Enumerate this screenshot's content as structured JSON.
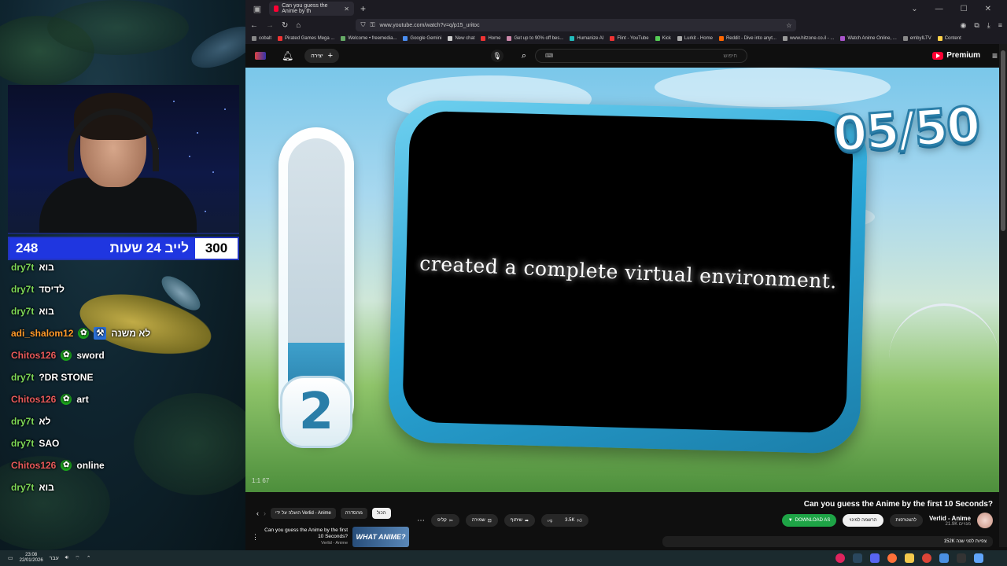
{
  "stream": {
    "counter": {
      "left_value": "248",
      "label": "לייב 24 שעות",
      "right_value": "300"
    },
    "chat": [
      {
        "user": "dry7t",
        "msg": "בוא",
        "color": "green",
        "badge": ""
      },
      {
        "user": "dry7t",
        "msg": "לדיסד",
        "color": "green",
        "badge": ""
      },
      {
        "user": "dry7t",
        "msg": "בוא",
        "color": "green",
        "badge": ""
      },
      {
        "user": "adi_shalom12",
        "msg": "לא משנה",
        "color": "orange",
        "badge": "both"
      },
      {
        "user": "Chitos126",
        "msg": "sword",
        "color": "red",
        "badge": "green"
      },
      {
        "user": "dry7t",
        "msg": "?DR STONE",
        "color": "green",
        "badge": ""
      },
      {
        "user": "Chitos126",
        "msg": "art",
        "color": "red",
        "badge": "green"
      },
      {
        "user": "dry7t",
        "msg": "לא",
        "color": "green",
        "badge": ""
      },
      {
        "user": "dry7t",
        "msg": "SAO",
        "color": "green",
        "badge": ""
      },
      {
        "user": "Chitos126",
        "msg": "online",
        "color": "red",
        "badge": "green"
      },
      {
        "user": "dry7t",
        "msg": "בוא",
        "color": "green",
        "badge": ""
      }
    ]
  },
  "browser": {
    "tab_title": "Can you guess the Anime by th",
    "url": "www.youtube.com/watch?v=q/p15_uritoc",
    "bookmarks": [
      "cobalt",
      "Pirated Games Mega ...",
      "Welcome • freemedia...",
      "Google Gemini",
      "New chat",
      "Home",
      "Get up to 90% off bes...",
      "Humanize AI",
      "Flint - YouTube",
      "Kick",
      "Lurkit - Home",
      "Reddit - Dive into anyt...",
      "www.hitzone.co.il - ...",
      "Watch Anime Online, ...",
      "embyILTV",
      "Content"
    ]
  },
  "youtube": {
    "create_label": "יצירה",
    "search_placeholder": "חיפוש",
    "logo_label": "Premium",
    "video": {
      "caption": "created a complete virtual environment.",
      "question_counter": "05/50",
      "timer_digit": "2",
      "timer_fill": 0.3,
      "time_label": "1:1 67"
    },
    "title": "Can you guess the Anime by the first 10 Seconds?",
    "channel": {
      "name": "Verlid - Anime",
      "subs": "21.9K מנויים"
    },
    "buttons": {
      "join": "להצטרפות",
      "subscribed": "הרשמה למינוי",
      "download": "DOWNLOAD AS",
      "likes": "3.5K",
      "share": "שיתוף",
      "save": "שמירה",
      "clip": "קליפ"
    },
    "desc_meta": "152K צפיות לפני שנה",
    "chips": [
      "הכול",
      "מהסדרה",
      "הועלה על ידי Verlid - Anime"
    ],
    "rec": {
      "title": "Can you guess the Anime by the first 10 Seconds?",
      "channel": "Verlid - Anime",
      "thumb_text": "WHAT ANIME?"
    }
  },
  "taskbar": {
    "time": "23:08",
    "date": "22/01/2026",
    "lang": "עבר"
  }
}
